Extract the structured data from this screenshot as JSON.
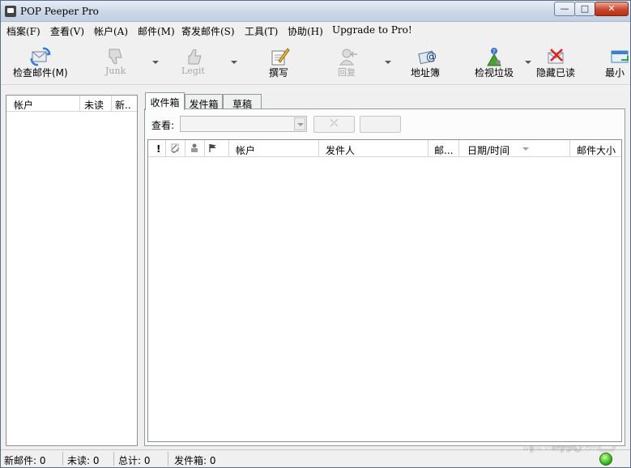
{
  "window": {
    "title": "POP Peeper Pro",
    "controls": {
      "minimize": "—",
      "maximize": "□",
      "close": "✕"
    }
  },
  "menu": [
    "档案(F)",
    "查看(V)",
    "帐户(A)",
    "邮件(M)",
    "寄发邮件(S)",
    "工具(T)",
    "协助(H)",
    "Upgrade to Pro!"
  ],
  "toolbar": {
    "check_mail": "检查邮件(M)",
    "junk": "Junk",
    "legit": "Legit",
    "compose": "撰写",
    "reply": "回复",
    "address_book": "地址簿",
    "view_junk": "检视垃圾",
    "hide_read": "隐藏已读",
    "minimize": "最小"
  },
  "accounts_panel": {
    "columns": [
      "帐户",
      "未读",
      "新.."
    ]
  },
  "tabs": [
    "收件箱",
    "发件箱",
    "草稿"
  ],
  "inbox": {
    "view_label": "查看:",
    "view_value": "",
    "filter_icon_glyph": "⤫"
  },
  "message_list": {
    "columns": [
      "!",
      "",
      "",
      "",
      "帐户",
      "发件人",
      "邮...",
      "日期/时间",
      "邮件大小"
    ],
    "rows": []
  },
  "statusbar": {
    "new_mail": "新邮件: 0",
    "unread": "未读: 0",
    "total": "总计: 0",
    "outbox": "发件箱: 0"
  },
  "watermark": {
    "text": "下载吧",
    "sub": "www.xiazaiba.com"
  },
  "colors": {
    "status_ok": "#35b81a",
    "disabled_text": "#a6a6a6",
    "close_button": "#c9462c"
  }
}
